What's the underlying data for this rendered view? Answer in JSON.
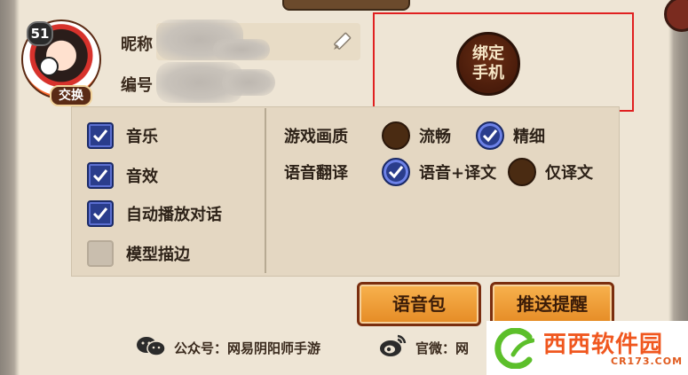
{
  "profile": {
    "level": "51",
    "swap_label": "交换",
    "nickname_label": "昵称",
    "id_label": "编号"
  },
  "bind_phone": {
    "label_line1": "绑定",
    "label_line2": "手机"
  },
  "left_options": [
    {
      "label": "音乐",
      "checked": true
    },
    {
      "label": "音效",
      "checked": true
    },
    {
      "label": "自动播放对话",
      "checked": true
    },
    {
      "label": "模型描边",
      "checked": false
    }
  ],
  "game_quality": {
    "label": "游戏画质",
    "options": [
      {
        "label": "流畅",
        "selected": false
      },
      {
        "label": "精细",
        "selected": true
      }
    ]
  },
  "voice_translate": {
    "label": "语音翻译",
    "options": [
      {
        "label": "语音+译文",
        "selected": true
      },
      {
        "label": "仅译文",
        "selected": false
      }
    ]
  },
  "buttons": {
    "voice_pack": "语音包",
    "push_reminder": "推送提醒"
  },
  "footer": {
    "wechat": "公众号：网易阴阳师手游",
    "weibo": "官微：网"
  },
  "watermark": {
    "title": "西西软件园",
    "url": "CR173.COM"
  },
  "colors": {
    "bind_highlight": "#e02020",
    "checkbox_on": "#2a3d8c",
    "button_orange": "#e58b25"
  }
}
